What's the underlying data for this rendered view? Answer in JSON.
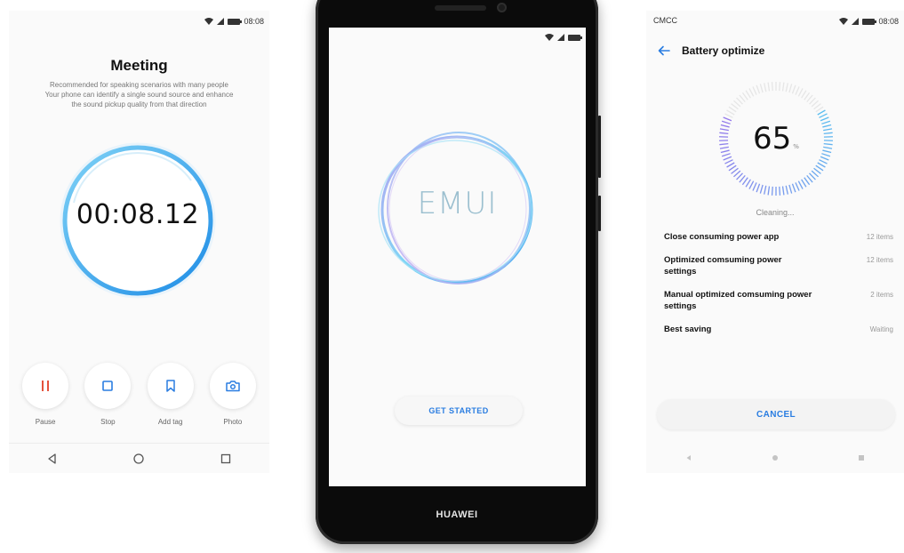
{
  "recorder": {
    "status_time": "08:08",
    "title": "Meeting",
    "description": [
      "Recommended for speaking scenarios with many people",
      "Your phone can identify a single sound source and enhance",
      "the sound pickup quality from that direction"
    ],
    "elapsed": "00:08.12",
    "controls": [
      {
        "label": "Pause",
        "icon": "pause-icon"
      },
      {
        "label": "Stop",
        "icon": "stop-icon"
      },
      {
        "label": "Add tag",
        "icon": "bookmark-icon"
      },
      {
        "label": "Photo",
        "icon": "camera-icon"
      }
    ]
  },
  "phone": {
    "logo": "EMUI",
    "cta_label": "GET STARTED",
    "brand": "HUAWEI"
  },
  "battery": {
    "carrier": "CMCC",
    "status_time": "08:08",
    "title": "Battery optimize",
    "score": "65",
    "score_unit": "%",
    "status": "Cleaning...",
    "items": [
      {
        "label": "Close consuming power app",
        "value": "12 items"
      },
      {
        "label": "Optimized comsuming power settings",
        "value": "12 items"
      },
      {
        "label": "Manual optimized comsuming power settings",
        "value": "2 items"
      },
      {
        "label": "Best saving",
        "value": "Waiting"
      }
    ],
    "cancel_label": "CANCEL"
  },
  "colors": {
    "accent": "#2a7de1",
    "pause_red": "#e5533d",
    "ring_blue": "#3aa0ef"
  }
}
